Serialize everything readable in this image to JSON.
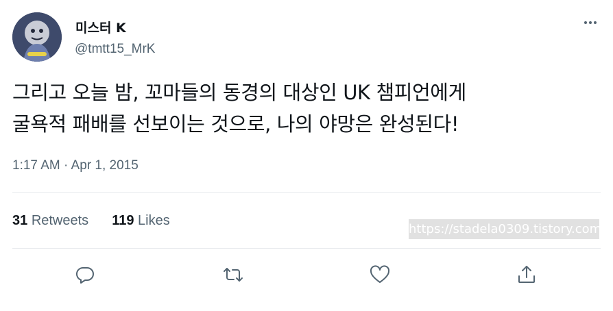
{
  "author": {
    "display_name": "미스터 K",
    "handle": "@tmtt15_MrK"
  },
  "tweet": {
    "lines": [
      "그리고 오늘 밤, 꼬마들의 동경의 대상인 UK 챔피언에게",
      "굴욕적 패배를 선보이는 것으로, 나의 야망은 완성된다!"
    ],
    "timestamp": "1:17 AM · Apr 1, 2015"
  },
  "stats": {
    "retweets_count": "31",
    "retweets_label": "Retweets",
    "likes_count": "119",
    "likes_label": "Likes"
  },
  "watermark": "https://stadela0309.tistory.com",
  "actions": {
    "icons": [
      "reply-icon",
      "retweet-icon",
      "like-icon",
      "share-icon"
    ]
  },
  "colors": {
    "text_primary": "#0f1419",
    "text_secondary": "#536471",
    "divider": "#e6e9ec"
  }
}
